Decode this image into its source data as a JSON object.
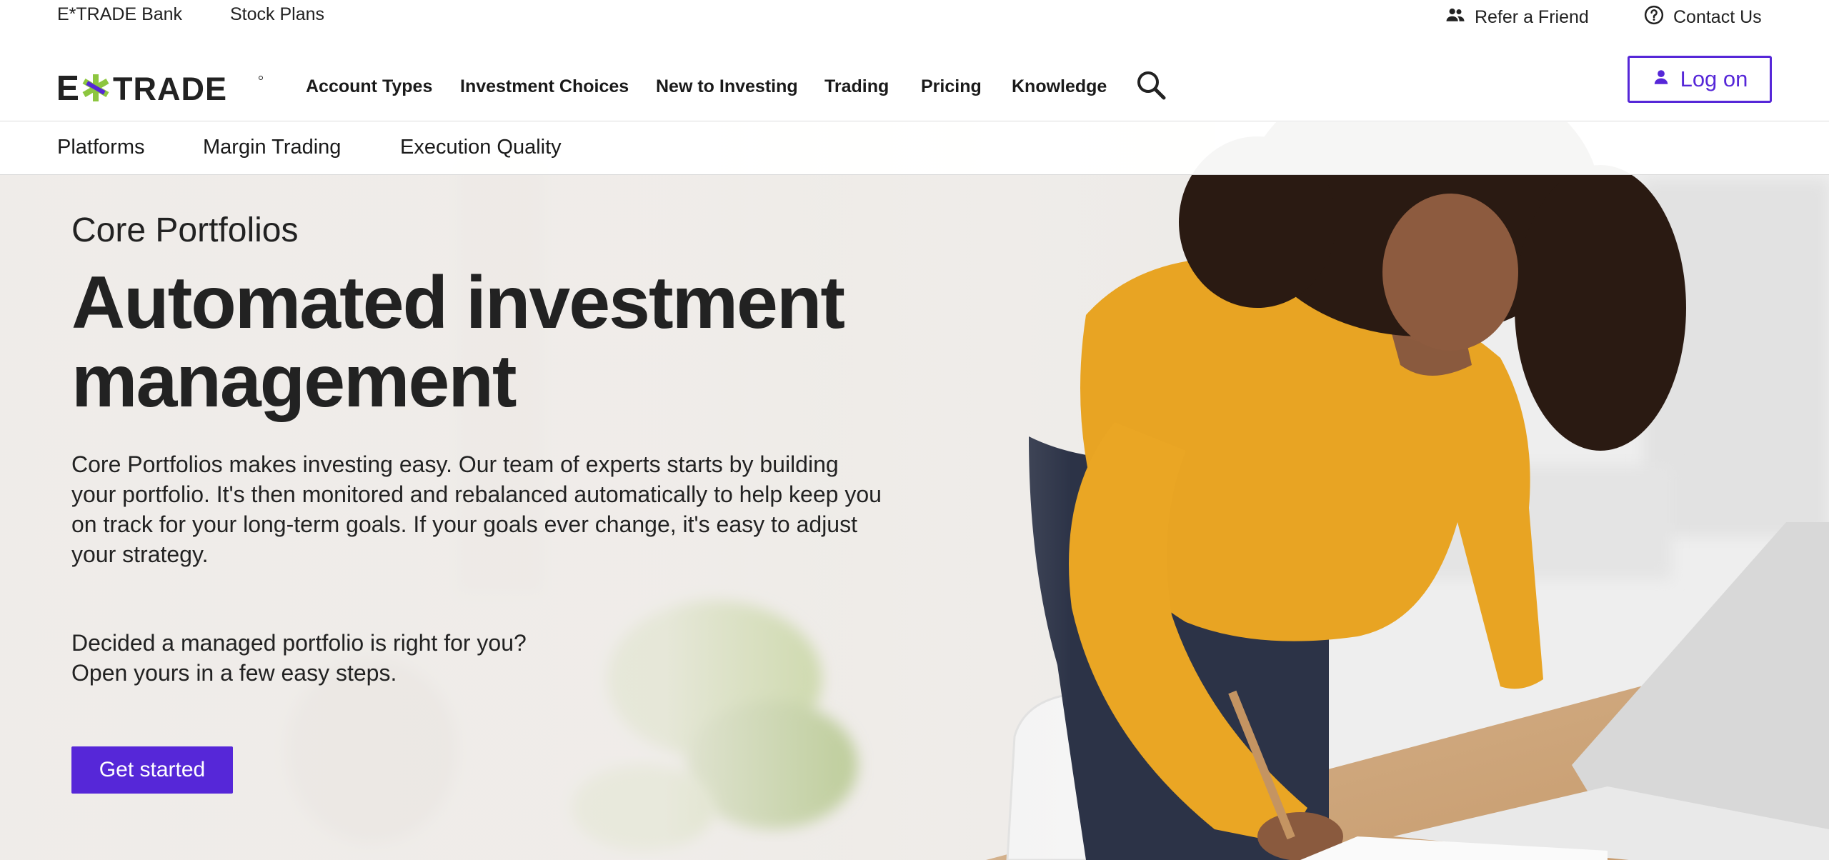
{
  "utility_bar": {
    "left_links": [
      "E*TRADE Bank",
      "Stock Plans"
    ],
    "refer_label": "Refer a Friend",
    "refer_icon": "people-icon",
    "contact_label": "Contact Us",
    "contact_icon": "question-circle-icon"
  },
  "brand": {
    "logo_text": "E*TRADE",
    "accent_color": "#8dc63f",
    "primary_color": "#5627d8"
  },
  "main_nav": {
    "items": [
      "Account Types",
      "Investment Choices",
      "New to Investing",
      "Trading",
      "Pricing",
      "Knowledge"
    ],
    "search_icon": "search-icon",
    "logon_label": "Log on",
    "logon_icon": "person-icon"
  },
  "sub_nav": {
    "items": [
      "Platforms",
      "Margin Trading",
      "Execution Quality"
    ]
  },
  "hero": {
    "eyebrow": "Core Portfolios",
    "headline_line1": "Automated investment",
    "headline_line2": "management",
    "body": "Core Portfolios makes investing easy. Our team of experts starts by building your portfolio. It's then monitored and rebalanced automatically to help keep you on track for your long-term goals. If your goals ever change, it's easy to adjust your strategy.",
    "cta_line1": "Decided a managed portfolio is right for you?",
    "cta_line2": "Open yours in a few easy steps.",
    "button_label": "Get started"
  }
}
